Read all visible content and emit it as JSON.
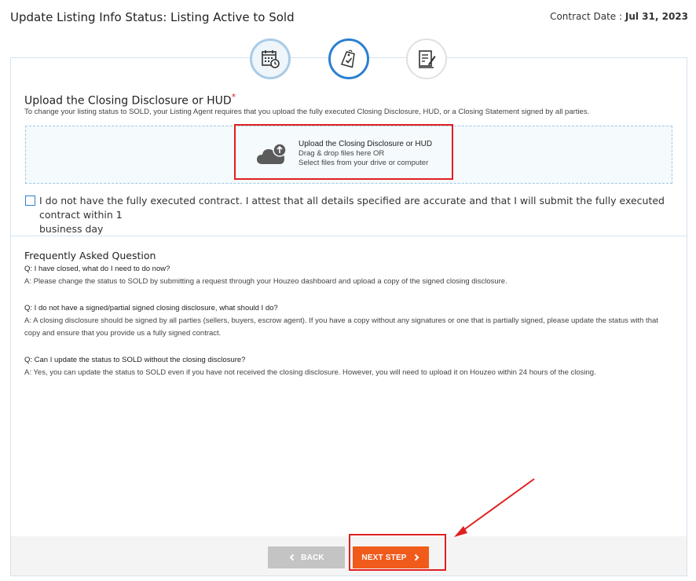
{
  "header": {
    "title": "Update Listing Info Status: Listing Active to Sold",
    "contract_date_label": "Contract Date : ",
    "contract_date_value": "Jul 31, 2023"
  },
  "steps": [
    {
      "icon": "calendar-clock-icon",
      "state": "completed"
    },
    {
      "icon": "tag-check-icon",
      "state": "active"
    },
    {
      "icon": "document-sign-icon",
      "state": "pending"
    }
  ],
  "upload": {
    "title": "Upload the Closing Disclosure or HUD",
    "required_mark": "*",
    "description": "To change your listing status to SOLD, your Listing Agent requires that you upload the fully executed Closing Disclosure, HUD, or a Closing Statement signed by all parties.",
    "dropzone": {
      "main": "Upload the Closing Disclosure or HUD",
      "line2": "Drag & drop files here OR",
      "line3": "Select files from your drive or computer"
    }
  },
  "attest": {
    "text_a": "I do not have the fully executed contract. I attest that all details specified are accurate and that I will submit the fully executed contract within ",
    "text_num": "1",
    "text_b": " business day"
  },
  "faq": {
    "title": "Frequently Asked Question",
    "items": [
      {
        "q": "Q: I have closed, what do I need to do now?",
        "a": "A: Please change the status to SOLD by submitting a request through your Houzeo dashboard and upload a copy of the signed closing disclosure."
      },
      {
        "q": "Q: I do not have a signed/partial signed closing disclosure, what should I do?",
        "a": "A: A closing disclosure should be signed by all parties (sellers, buyers, escrow agent). If you have a copy without any signatures or one that is partially signed, please update the status with that copy and ensure that you provide us a fully signed contract."
      },
      {
        "q": "Q: Can I update the status to SOLD without the closing disclosure?",
        "a": "A: Yes, you can update the status to SOLD even if you have not received the closing disclosure. However, you will need to upload it on Houzeo within 24 hours of the closing."
      }
    ]
  },
  "footer": {
    "back_label": "BACK",
    "next_label": "NEXT STEP"
  },
  "colors": {
    "accent_blue": "#2c7fd1",
    "next_orange": "#f05a1a",
    "highlight_red": "#e02020"
  }
}
